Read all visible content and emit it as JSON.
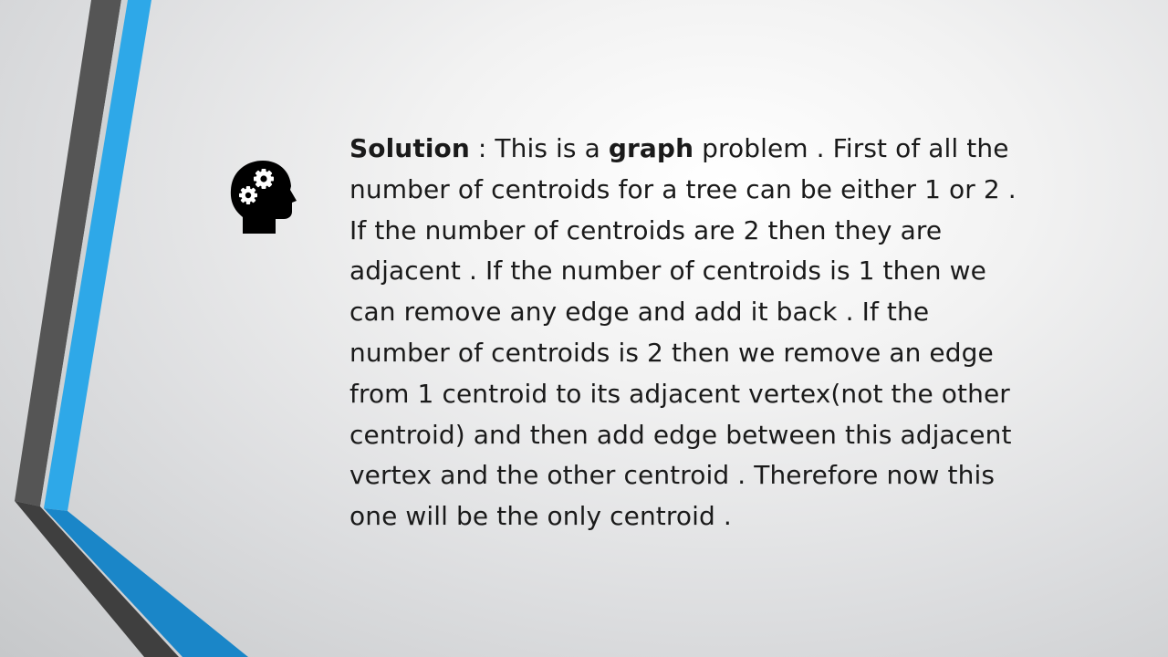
{
  "slide": {
    "icon": "head-with-gears-icon",
    "accent_colors": {
      "dark_bar": "#4d4d4d",
      "blue_bar": "#2ea8e8",
      "blue_deep": "#1a86c8"
    },
    "lines": [
      {
        "segments": [
          {
            "text": "Solution",
            "bold": true
          },
          {
            "text": " : This is a ",
            "bold": false
          },
          {
            "text": "graph",
            "bold": true
          },
          {
            "text": " problem . First of all the",
            "bold": false
          }
        ]
      },
      {
        "segments": [
          {
            "text": "number of centroids for a tree can be either 1 or 2 .",
            "bold": false
          }
        ]
      },
      {
        "segments": [
          {
            "text": "If the number of centroids are 2 then they are",
            "bold": false
          }
        ]
      },
      {
        "segments": [
          {
            "text": "adjacent . If the number of centroids is 1 then we",
            "bold": false
          }
        ]
      },
      {
        "segments": [
          {
            "text": "can remove any edge and add it back . If the",
            "bold": false
          }
        ]
      },
      {
        "segments": [
          {
            "text": "number of centroids is 2 then we remove an edge",
            "bold": false
          }
        ]
      },
      {
        "segments": [
          {
            "text": "from 1 centroid to its adjacent vertex(not the other",
            "bold": false
          }
        ]
      },
      {
        "segments": [
          {
            "text": "centroid) and then add edge between this adjacent",
            "bold": false
          }
        ]
      },
      {
        "segments": [
          {
            "text": "vertex and the other centroid . Therefore now this",
            "bold": false
          }
        ]
      },
      {
        "segments": [
          {
            "text": "one will be the only centroid .",
            "bold": false
          }
        ]
      }
    ]
  }
}
